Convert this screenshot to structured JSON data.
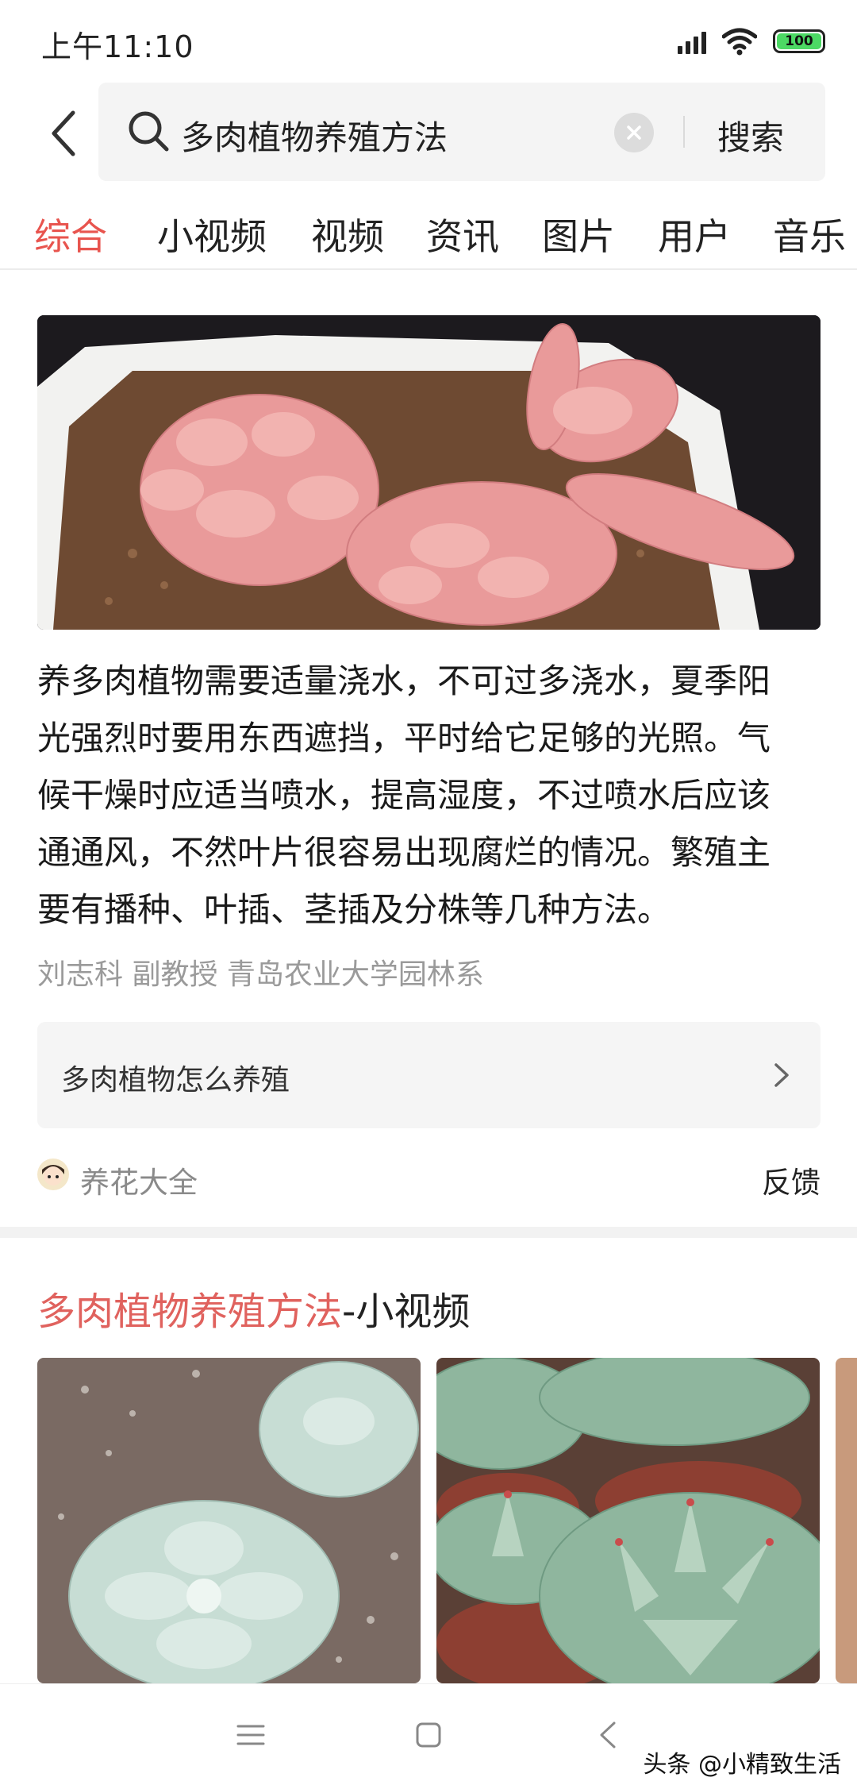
{
  "status_bar": {
    "time": "上午11:10",
    "battery": "100",
    "battery_color": "#4cd964"
  },
  "search": {
    "back_icon": "chevron-left-icon",
    "search_icon": "magnifier-icon",
    "query": "多肉植物养殖方法",
    "clear_icon": "close-circle-icon",
    "submit_label": "搜索"
  },
  "tabs": [
    {
      "label": "综合",
      "active": true
    },
    {
      "label": "小视频",
      "active": false
    },
    {
      "label": "视频",
      "active": false
    },
    {
      "label": "资讯",
      "active": false
    },
    {
      "label": "图片",
      "active": false
    },
    {
      "label": "用户",
      "active": false
    },
    {
      "label": "音乐",
      "active": false
    }
  ],
  "accent_color": "#e8544e",
  "answer": {
    "lines": [
      "养多肉植物需要适量浇水，不可过多浇水，夏季阳",
      "光强烈时要用东西遮挡，平时给它足够的光照。气",
      "候干燥时应适当喷水，提高湿度，不过喷水后应该",
      "通通风，不然叶片很容易出现腐烂的情况。繁殖主",
      "要有播种、叶插、茎插及分株等几种方法。"
    ],
    "source": "刘志科 副教授 青岛农业大学园林系"
  },
  "related": {
    "question": "多肉植物怎么养殖",
    "arrow_icon": "chevron-right-icon"
  },
  "site": {
    "name": "养花大全",
    "feedback_label": "反馈"
  },
  "video_section": {
    "title_highlight": "多肉植物养殖方法",
    "title_suffix": "-小视频"
  },
  "nav": {
    "menu_icon": "menu-icon",
    "home_icon": "square-home-icon",
    "back_icon": "back-triangle-icon"
  },
  "watermark": "头条 @小精致生活"
}
